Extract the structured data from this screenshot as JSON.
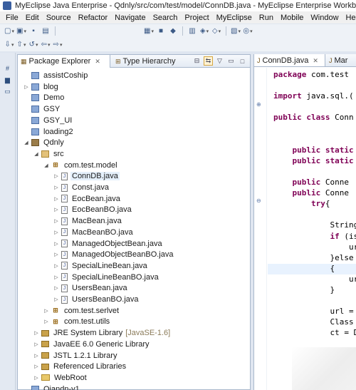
{
  "window": {
    "title": "MyEclipse Java Enterprise - Qdnly/src/com/test/model/ConnDB.java - MyEclipse Enterprise Workbench"
  },
  "menu": [
    "File",
    "Edit",
    "Source",
    "Refactor",
    "Navigate",
    "Search",
    "Project",
    "MyEclipse",
    "Run",
    "Mobile",
    "Window",
    "Help"
  ],
  "package_explorer": {
    "tab_label": "Package Explorer",
    "tab_close": "✕",
    "other_tab_label": "Type Hierarchy",
    "tree": [
      {
        "label": "assistCoship",
        "level": 0,
        "icon": "project-icon",
        "twisty": ""
      },
      {
        "label": "blog",
        "level": 0,
        "icon": "project-icon",
        "twisty": "▷"
      },
      {
        "label": "Demo",
        "level": 0,
        "icon": "project-icon",
        "twisty": ""
      },
      {
        "label": "GSY",
        "level": 0,
        "icon": "project-icon",
        "twisty": ""
      },
      {
        "label": "GSY_UI",
        "level": 0,
        "icon": "project-icon",
        "twisty": ""
      },
      {
        "label": "loading2",
        "level": 0,
        "icon": "project-icon",
        "twisty": ""
      },
      {
        "label": "Qdnly",
        "level": 0,
        "icon": "project-decorated-icon",
        "twisty": "◢"
      },
      {
        "label": "src",
        "level": 1,
        "icon": "source-folder-icon",
        "twisty": "◢"
      },
      {
        "label": "com.test.model",
        "level": 2,
        "icon": "package-icon",
        "twisty": "◢"
      },
      {
        "label": "ConnDB.java",
        "level": 3,
        "icon": "java-file-icon",
        "twisty": "▷",
        "selected": true
      },
      {
        "label": "Const.java",
        "level": 3,
        "icon": "java-file-icon",
        "twisty": "▷"
      },
      {
        "label": "EocBean.java",
        "level": 3,
        "icon": "java-file-icon",
        "twisty": "▷"
      },
      {
        "label": "EocBeanBO.java",
        "level": 3,
        "icon": "java-file-icon",
        "twisty": "▷"
      },
      {
        "label": "MacBean.java",
        "level": 3,
        "icon": "java-file-icon",
        "twisty": "▷"
      },
      {
        "label": "MacBeanBO.java",
        "level": 3,
        "icon": "java-file-icon",
        "twisty": "▷"
      },
      {
        "label": "ManagedObjectBean.java",
        "level": 3,
        "icon": "java-file-icon",
        "twisty": "▷"
      },
      {
        "label": "ManagedObjectBeanBO.java",
        "level": 3,
        "icon": "java-file-icon",
        "twisty": "▷"
      },
      {
        "label": "SpecialLineBean.java",
        "level": 3,
        "icon": "java-file-icon",
        "twisty": "▷"
      },
      {
        "label": "SpecialLineBeanBO.java",
        "level": 3,
        "icon": "java-file-icon",
        "twisty": "▷"
      },
      {
        "label": "UsersBean.java",
        "level": 3,
        "icon": "java-file-icon",
        "twisty": "▷"
      },
      {
        "label": "UsersBeanBO.java",
        "level": 3,
        "icon": "java-file-icon",
        "twisty": "▷"
      },
      {
        "label": "com.test.serlvet",
        "level": 2,
        "icon": "package-icon",
        "twisty": "▷"
      },
      {
        "label": "com.test.utils",
        "level": 2,
        "icon": "package-icon",
        "twisty": "▷"
      },
      {
        "label": "JRE System Library",
        "level": 1,
        "icon": "library-icon",
        "twisty": "▷",
        "decor": "[JavaSE-1.6]"
      },
      {
        "label": "JavaEE 6.0 Generic Library",
        "level": 1,
        "icon": "library-icon",
        "twisty": "▷"
      },
      {
        "label": "JSTL 1.2.1 Library",
        "level": 1,
        "icon": "library-icon",
        "twisty": "▷"
      },
      {
        "label": "Referenced Libraries",
        "level": 1,
        "icon": "library-icon",
        "twisty": "▷"
      },
      {
        "label": "WebRoot",
        "level": 1,
        "icon": "folder-icon",
        "twisty": "▷"
      },
      {
        "label": "Qiandn-v1",
        "level": 0,
        "icon": "project-icon",
        "twisty": ""
      }
    ]
  },
  "editor": {
    "active_tab": "ConnDB.java",
    "tab_close": "✕",
    "other_tab": "Mar",
    "lines": [
      {
        "kw": "package",
        "rest": " com.test"
      },
      {
        "kw": "",
        "rest": ""
      },
      {
        "kw": "import",
        "rest": " java.sql.("
      },
      {
        "kw": "",
        "rest": ""
      },
      {
        "kw": "public class",
        "rest": " Conn"
      },
      {
        "kw": "",
        "rest": ""
      },
      {
        "kw": "",
        "rest": ""
      },
      {
        "kw": "    public static",
        "rest": ""
      },
      {
        "kw": "    public static",
        "rest": ""
      },
      {
        "kw": "",
        "rest": ""
      },
      {
        "kw": "    public",
        "rest": " Conne"
      },
      {
        "kw": "    public",
        "rest": " Conne"
      },
      {
        "kw": "        try",
        "rest": "{"
      },
      {
        "kw": "",
        "rest": ""
      },
      {
        "kw": "",
        "rest": "            String"
      },
      {
        "kw": "            if",
        "rest": " (is"
      },
      {
        "kw": "",
        "rest": "                ur"
      },
      {
        "kw": "",
        "rest": "            }else"
      },
      {
        "kw": "",
        "rest": "            {"
      },
      {
        "kw": "",
        "rest": "                ur"
      },
      {
        "kw": "",
        "rest": "            }"
      },
      {
        "kw": "",
        "rest": ""
      },
      {
        "kw": "",
        "rest": "            url ="
      },
      {
        "kw": "",
        "rest": "            Class"
      },
      {
        "kw": "",
        "rest": "            ct = D"
      }
    ]
  }
}
